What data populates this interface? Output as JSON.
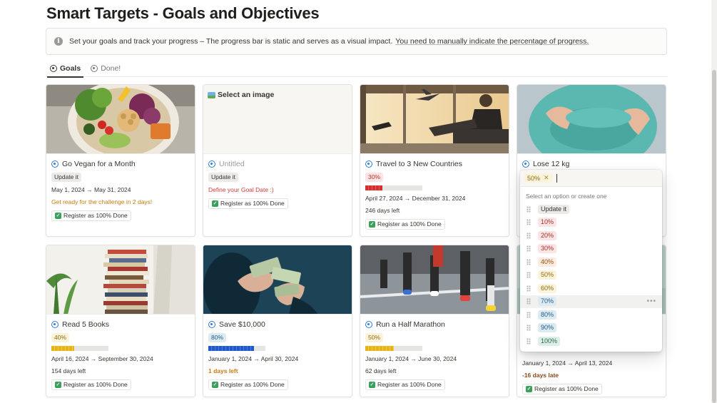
{
  "page": {
    "title": "Smart Targets - Goals and Objectives"
  },
  "callout": {
    "icon": "info-icon",
    "text": "Set your goals and track your progress – The progress bar is static and serves as a visual impact.",
    "link_text": "You need to manually indicate the percentage of progress."
  },
  "tabs": [
    {
      "label": "Goals",
      "icon": "target-icon",
      "active": true
    },
    {
      "label": "Done!",
      "icon": "target-icon",
      "active": false
    }
  ],
  "cards": [
    {
      "title": "Go Vegan for a Month",
      "progress_tag": "Update it",
      "tag_color": "gray",
      "progress": null,
      "dates": "May 1, 2024 → May 31, 2024",
      "status": "Get ready for the challenge in 2 days!",
      "status_color": "orange",
      "done_label": "Register as 100% Done",
      "cover": "vegan-bowl"
    },
    {
      "title": "Untitled",
      "cover_label": "Select an image",
      "progress_tag": "Update it",
      "tag_color": "gray",
      "progress": null,
      "dates": "",
      "status": "Define your Goal Date :)",
      "status_color": "red",
      "done_label": "Register as 100% Done",
      "cover": "empty"
    },
    {
      "title": "Travel to 3 New Countries",
      "progress_tag": "30%",
      "tag_color": "red",
      "progress": 0.3,
      "dates": "April 27, 2024 → December 31, 2024",
      "status": "246 days left",
      "status_color": "normal",
      "done_label": "Register as 100% Done",
      "cover": "airport"
    },
    {
      "title": "Lose 12 kg",
      "progress_tag": "",
      "tag_color": "yellow",
      "progress": 0.5,
      "dates": "January 1, 2024 → April 13, 2024",
      "status": "-16 days late",
      "status_color": "brown",
      "done_label": "Register as 100% Done",
      "cover": "belly"
    },
    {
      "title": "Read 5 Books",
      "progress_tag": "40%",
      "tag_color": "yellow",
      "progress": 0.4,
      "dates": "April 16, 2024 → September 30, 2024",
      "status": "154 days left",
      "status_color": "normal",
      "done_label": "Register as 100% Done",
      "cover": "books"
    },
    {
      "title": "Save $10,000",
      "progress_tag": "80%",
      "tag_color": "blue",
      "progress": 0.8,
      "dates": "January 1, 2024 → April 30, 2024",
      "status": "1 days left",
      "status_color": "orange-bold",
      "done_label": "Register as 100% Done",
      "cover": "money"
    },
    {
      "title": "Run a Half Marathon",
      "progress_tag": "50%",
      "tag_color": "yellow",
      "progress": 0.5,
      "dates": "January 1, 2024 → June 30, 2024",
      "status": "62 days left",
      "status_color": "normal",
      "done_label": "Register as 100% Done",
      "cover": "runners"
    },
    {
      "title": "",
      "progress_tag": "",
      "tag_color": "gray",
      "progress": null,
      "dates": "January 1, 2024 → April 13, 2024",
      "status": "-16 days late",
      "status_color": "brown",
      "done_label": "Register as 100% Done",
      "cover": "teal"
    }
  ],
  "dropdown": {
    "selected": "50%",
    "hint": "Select an option or create one",
    "options": [
      {
        "label": "Update it",
        "color": "gray"
      },
      {
        "label": "10%",
        "color": "red"
      },
      {
        "label": "20%",
        "color": "red"
      },
      {
        "label": "30%",
        "color": "red"
      },
      {
        "label": "40%",
        "color": "orange"
      },
      {
        "label": "50%",
        "color": "yellow"
      },
      {
        "label": "60%",
        "color": "yellow"
      },
      {
        "label": "70%",
        "color": "blue",
        "hover": true
      },
      {
        "label": "80%",
        "color": "blue"
      },
      {
        "label": "90%",
        "color": "blue"
      },
      {
        "label": "100%",
        "color": "green"
      }
    ]
  },
  "colors": {
    "goal_icon": "#2f7dd0",
    "accent_text": "#37352f"
  }
}
